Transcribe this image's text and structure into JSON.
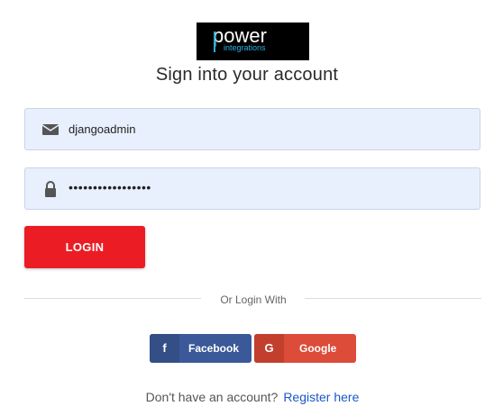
{
  "logo": {
    "line1": "power",
    "line2": "integrations"
  },
  "page": {
    "title": "Sign into your account"
  },
  "form": {
    "username_value": "djangoadmin",
    "password_value": "•••••••••••••••••",
    "login_label": "LOGIN"
  },
  "divider": {
    "text": "Or Login With"
  },
  "social": {
    "facebook": {
      "icon": "f",
      "label": "Facebook",
      "color": "#3b5998"
    },
    "google": {
      "icon": "G",
      "label": "Google",
      "color": "#dd4b39"
    }
  },
  "footer": {
    "prompt": "Don't have an account?",
    "register_link": "Register here"
  },
  "colors": {
    "accent": "#ec1c24",
    "field_bg": "#e8f0fe",
    "link": "#1a58c8"
  }
}
